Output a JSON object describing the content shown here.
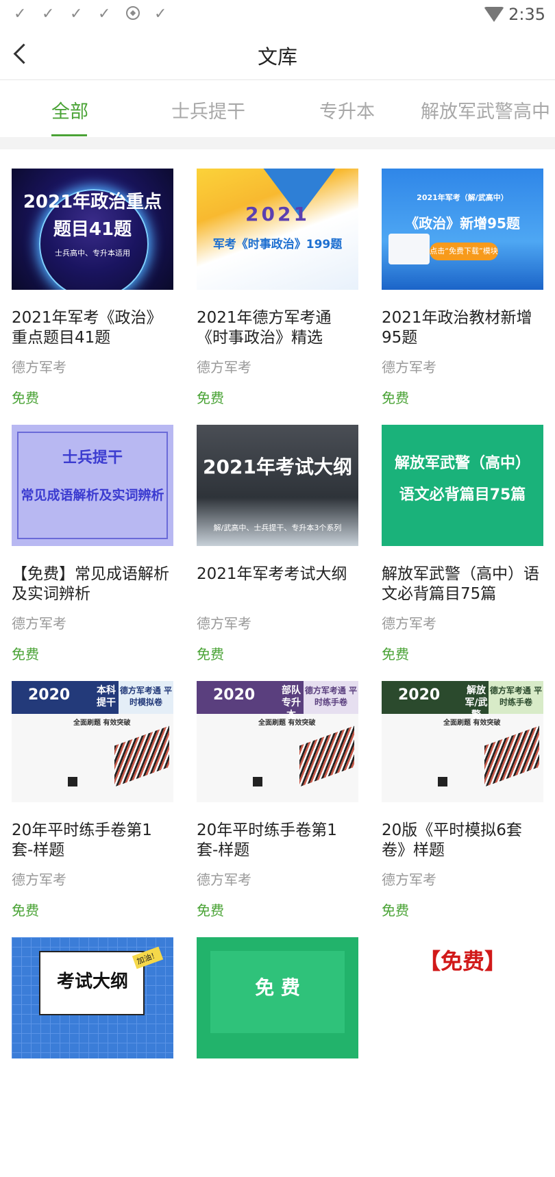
{
  "status_bar": {
    "time": "2:35",
    "icons": [
      "check-icon",
      "check-icon",
      "check-icon",
      "check-icon",
      "shield-icon",
      "check-icon",
      "wifi-icon"
    ]
  },
  "header": {
    "title": "文库"
  },
  "tabs": [
    {
      "label": "全部",
      "active": true
    },
    {
      "label": "士兵提干",
      "active": false
    },
    {
      "label": "专升本",
      "active": false
    },
    {
      "label": "解放军武警高中",
      "active": false
    }
  ],
  "colors": {
    "accent": "#4aa336",
    "muted": "#999999"
  },
  "docs": [
    {
      "title": "2021年军考《政治》重点题目41题",
      "author": "德方军考",
      "price": "免费",
      "cover": {
        "line1": "2021年政治重点",
        "line2": "题目41题",
        "line3": "士兵高中、专升本适用"
      }
    },
    {
      "title": "2021年德方军考通《时事政治》精选",
      "author": "德方军考",
      "price": "免费",
      "cover": {
        "line1": "2021",
        "line2": "军考《时事政治》199题"
      }
    },
    {
      "title": "2021年政治教材新增95题",
      "author": "德方军考",
      "price": "免费",
      "cover": {
        "line1": "2021年军考（解/武高中）",
        "line2": "《政治》新增95题",
        "line3": "点击“免费下载”模块"
      }
    },
    {
      "title": "【免费】常见成语解析及实词辨析",
      "author": "德方军考",
      "price": "免费",
      "cover": {
        "line1": "士兵提干",
        "line2": "常见成语解析及实词辨析"
      }
    },
    {
      "title": "2021年军考考试大纲",
      "author": "德方军考",
      "price": "免费",
      "cover": {
        "line1": "2021年考试大纲",
        "line2": "解/武高中、士兵提干、专升本3个系列"
      }
    },
    {
      "title": "解放军武警（高中）语文必背篇目75篇",
      "author": "德方军考",
      "price": "免费",
      "cover": {
        "line1": "解放军武警（高中）",
        "line2": "语文必背篇目75篇"
      }
    },
    {
      "title": "20年平时练手卷第1套-样题",
      "author": "德方军考",
      "price": "免费",
      "cover": {
        "year": "2020",
        "mid": "本科提干",
        "right": "德方军考通 平时模拟卷",
        "sub": "全面刷题 有效突破"
      }
    },
    {
      "title": "20年平时练手卷第1套-样题",
      "author": "德方军考",
      "price": "免费",
      "cover": {
        "year": "2020",
        "mid": "部队专升本",
        "right": "德方军考通 平时练手卷",
        "sub": "全面刷题 有效突破"
      }
    },
    {
      "title": "20版《平时模拟6套卷》样题",
      "author": "德方军考",
      "price": "免费",
      "cover": {
        "year": "2020",
        "mid": "解放军/武警",
        "right": "德方军考通 平时练手卷",
        "sub": "全面刷题 有效突破"
      }
    },
    {
      "title": "",
      "author": "",
      "price": "",
      "cover": {
        "line1": "考试大纲",
        "line2": "加油！"
      }
    },
    {
      "title": "",
      "author": "",
      "price": "",
      "cover": {
        "line1": "免 费"
      }
    },
    {
      "title": "",
      "author": "",
      "price": "",
      "cover": {
        "line1": "【免费】"
      }
    }
  ]
}
